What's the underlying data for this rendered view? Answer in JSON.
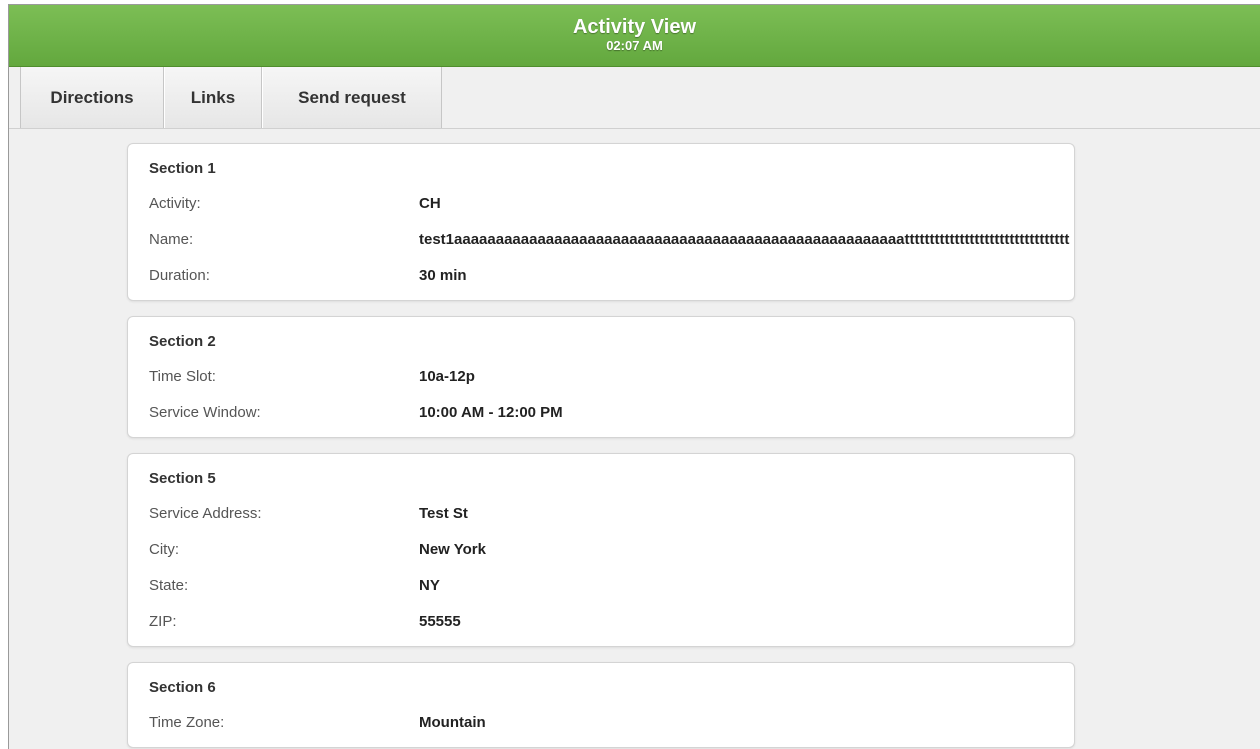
{
  "header": {
    "title": "Activity View",
    "time": "02:07 AM"
  },
  "toolbar": {
    "tabs": [
      {
        "label": "Directions"
      },
      {
        "label": "Links"
      },
      {
        "label": "Send request"
      }
    ]
  },
  "sections": [
    {
      "title": "Section 1",
      "rows": [
        {
          "label": "Activity:",
          "value": "CH"
        },
        {
          "label": "Name:",
          "value": "test1aaaaaaaaaaaaaaaaaaaaaaaaaaaaaaaaaaaaaaaaaaaaaaaaaaaaaattttttttttttttttttttttttttttttttt"
        },
        {
          "label": "Duration:",
          "value": "30 min"
        }
      ]
    },
    {
      "title": "Section 2",
      "rows": [
        {
          "label": "Time Slot:",
          "value": "10a-12p"
        },
        {
          "label": "Service Window:",
          "value": "10:00 AM - 12:00 PM"
        }
      ]
    },
    {
      "title": "Section 5",
      "rows": [
        {
          "label": "Service Address:",
          "value": "Test St"
        },
        {
          "label": "City:",
          "value": "New York"
        },
        {
          "label": "State:",
          "value": "NY"
        },
        {
          "label": "ZIP:",
          "value": "55555"
        }
      ]
    },
    {
      "title": "Section 6",
      "rows": [
        {
          "label": "Time Zone:",
          "value": "Mountain"
        }
      ]
    }
  ]
}
